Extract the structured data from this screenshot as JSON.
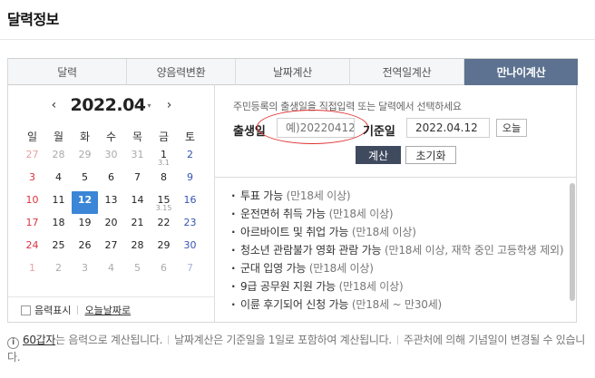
{
  "page": {
    "title": "달력정보"
  },
  "tabs": [
    {
      "label": "달력"
    },
    {
      "label": "양음력변환"
    },
    {
      "label": "날짜계산"
    },
    {
      "label": "전역일계산"
    },
    {
      "label": "만나이계산"
    }
  ],
  "calendar": {
    "prev_arrow": "‹",
    "next_arrow": "›",
    "month_label": "2022.04",
    "caret": "▾",
    "weekdays": [
      "일",
      "월",
      "화",
      "수",
      "목",
      "금",
      "토"
    ],
    "weeks": [
      [
        {
          "d": "27",
          "o": true
        },
        {
          "d": "28",
          "o": true
        },
        {
          "d": "29",
          "o": true
        },
        {
          "d": "30",
          "o": true
        },
        {
          "d": "31",
          "o": true
        },
        {
          "d": "1",
          "l": "3.1"
        },
        {
          "d": "2"
        }
      ],
      [
        {
          "d": "3"
        },
        {
          "d": "4"
        },
        {
          "d": "5"
        },
        {
          "d": "6"
        },
        {
          "d": "7"
        },
        {
          "d": "8"
        },
        {
          "d": "9"
        }
      ],
      [
        {
          "d": "10"
        },
        {
          "d": "11"
        },
        {
          "d": "12",
          "s": true
        },
        {
          "d": "13"
        },
        {
          "d": "14"
        },
        {
          "d": "15",
          "l": "3.15"
        },
        {
          "d": "16"
        }
      ],
      [
        {
          "d": "17"
        },
        {
          "d": "18"
        },
        {
          "d": "19"
        },
        {
          "d": "20"
        },
        {
          "d": "21"
        },
        {
          "d": "22"
        },
        {
          "d": "23"
        }
      ],
      [
        {
          "d": "24"
        },
        {
          "d": "25"
        },
        {
          "d": "26"
        },
        {
          "d": "27"
        },
        {
          "d": "28"
        },
        {
          "d": "29"
        },
        {
          "d": "30"
        }
      ],
      [
        {
          "d": "1",
          "o": true
        },
        {
          "d": "2",
          "o": true
        },
        {
          "d": "3",
          "o": true
        },
        {
          "d": "4",
          "o": true
        },
        {
          "d": "5",
          "o": true
        },
        {
          "d": "6",
          "o": true
        },
        {
          "d": "7",
          "o": true
        }
      ]
    ],
    "lunar_toggle": "음력표시",
    "today_link": "오늘날짜로"
  },
  "calc": {
    "hint": "주민등록의 출생일을 직접입력 또는 달력에서 선택하세요",
    "birth_label": "출생일",
    "birth_placeholder": "예)20220412",
    "base_label": "기준일",
    "base_value": "2022.04.12",
    "today_button": "오늘",
    "calc_button": "계산",
    "reset_button": "초기화"
  },
  "results": [
    {
      "text": "투표 가능",
      "age": "(만18세 이상)"
    },
    {
      "text": "운전면허 취득 가능",
      "age": "(만18세 이상)"
    },
    {
      "text": "아르바이트 및 취업 가능",
      "age": "(만18세 이상)"
    },
    {
      "text": "청소년 관람불가 영화 관람 가능",
      "age": "(만18세 이상, 재학 중인 고등학생 제외)"
    },
    {
      "text": "군대 입영 가능",
      "age": "(만18세 이상)"
    },
    {
      "text": "9급 공무원 지원 가능",
      "age": "(만18세 이상)"
    },
    {
      "text": "이륜 후기되어 신청 가능",
      "age": "(만18세 ~ 만30세)"
    }
  ],
  "note": {
    "info_icon": "i",
    "ganji_link": "60갑자",
    "part1": "는 음력으로 계산됩니다.",
    "part2": "날짜계산은 기준일을 1일로 포함하여 계산됩니다.",
    "part3": "주관처에 의해 기념일이 변경될 수 있습니다."
  },
  "colors": {
    "accent_tab": "#5d7290",
    "selected_day": "#3b86d6",
    "calc_button": "#3f4a5f",
    "highlight_circle": "#e03030",
    "sunday": "#d9333f",
    "saturday": "#3555b0"
  }
}
